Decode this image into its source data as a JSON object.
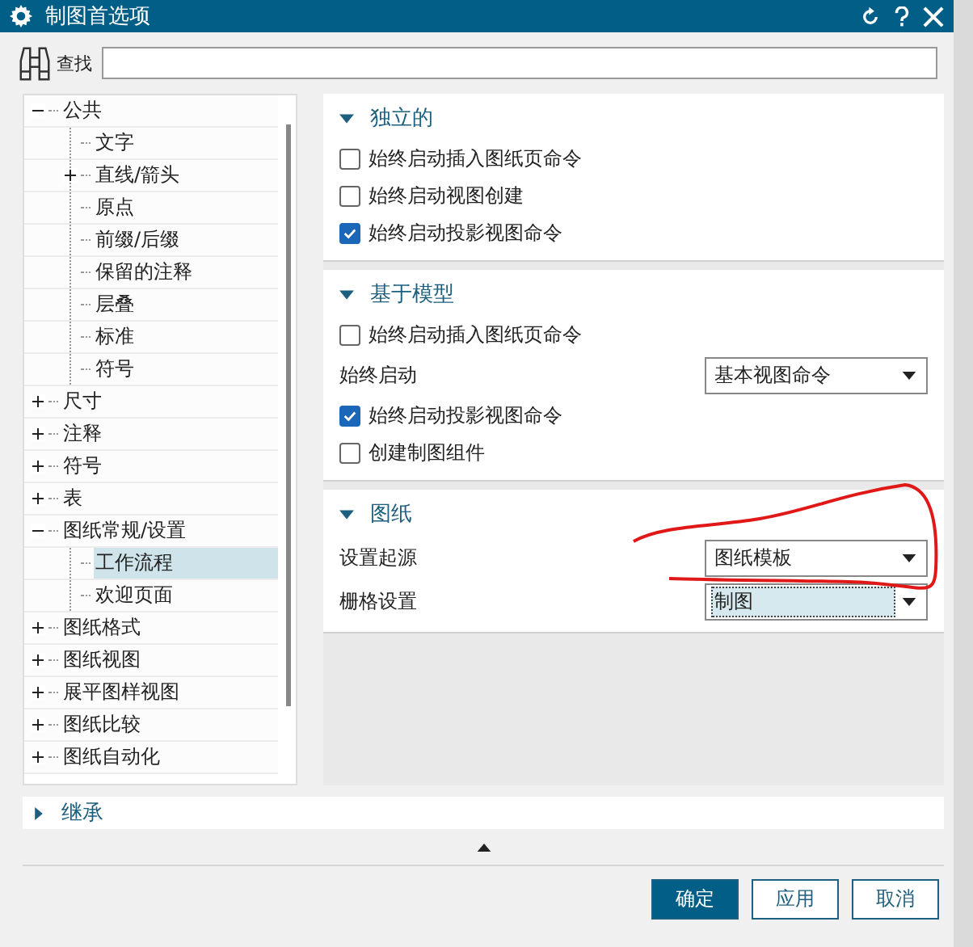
{
  "window": {
    "title": "制图首选项"
  },
  "search": {
    "label": "查找"
  },
  "tree": {
    "items": [
      {
        "label": "公共",
        "expanded": true,
        "selected": false,
        "children": [
          {
            "label": "文字",
            "selected": false
          },
          {
            "label": "直线/箭头",
            "expanded": false,
            "selected": false
          },
          {
            "label": "原点",
            "selected": false
          },
          {
            "label": "前缀/后缀",
            "selected": false
          },
          {
            "label": "保留的注释",
            "selected": false
          },
          {
            "label": "层叠",
            "selected": false
          },
          {
            "label": "标准",
            "selected": false
          },
          {
            "label": "符号",
            "selected": false
          }
        ]
      },
      {
        "label": "尺寸",
        "expanded": false,
        "selected": false
      },
      {
        "label": "注释",
        "expanded": false,
        "selected": false
      },
      {
        "label": "符号",
        "expanded": false,
        "selected": false
      },
      {
        "label": "表",
        "expanded": false,
        "selected": false
      },
      {
        "label": "图纸常规/设置",
        "expanded": true,
        "selected": false,
        "children": [
          {
            "label": "工作流程",
            "selected": true
          },
          {
            "label": "欢迎页面",
            "selected": false
          }
        ]
      },
      {
        "label": "图纸格式",
        "expanded": false,
        "selected": false
      },
      {
        "label": "图纸视图",
        "expanded": false,
        "selected": false
      },
      {
        "label": "展平图样视图",
        "expanded": false,
        "selected": false
      },
      {
        "label": "图纸比较",
        "expanded": false,
        "selected": false
      },
      {
        "label": "图纸自动化",
        "expanded": false,
        "selected": false
      }
    ]
  },
  "sections": [
    {
      "title": "独立的",
      "expanded": true,
      "rows": [
        {
          "kind": "checkbox",
          "label": "始终启动插入图纸页命令",
          "checked": false
        },
        {
          "kind": "checkbox",
          "label": "始终启动视图创建",
          "checked": false
        },
        {
          "kind": "checkbox",
          "label": "始终启动投影视图命令",
          "checked": true
        }
      ]
    },
    {
      "title": "基于模型",
      "expanded": true,
      "rows": [
        {
          "kind": "checkbox",
          "label": "始终启动插入图纸页命令",
          "checked": false
        },
        {
          "kind": "dropdown",
          "label": "始终启动",
          "value": "基本视图命令",
          "focused": false
        },
        {
          "kind": "checkbox",
          "label": "始终启动投影视图命令",
          "checked": true
        },
        {
          "kind": "checkbox",
          "label": "创建制图组件",
          "checked": false
        }
      ]
    },
    {
      "title": "图纸",
      "expanded": true,
      "rows": [
        {
          "kind": "dropdown",
          "label": "设置起源",
          "value": "图纸模板",
          "focused": false
        },
        {
          "kind": "dropdown",
          "label": "栅格设置",
          "value": "制图",
          "focused": true
        }
      ]
    }
  ],
  "inherit": {
    "label": "继承",
    "expanded": false
  },
  "buttons": [
    {
      "label": "确定",
      "default": true
    },
    {
      "label": "应用",
      "default": false
    },
    {
      "label": "取消",
      "default": false
    }
  ]
}
